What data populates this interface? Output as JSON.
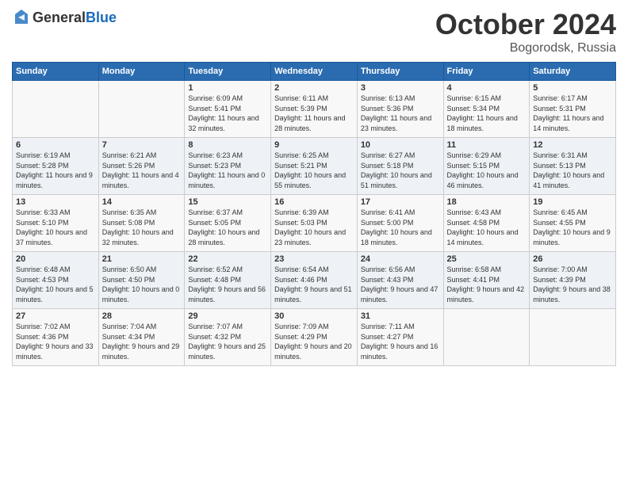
{
  "header": {
    "logo_general": "General",
    "logo_blue": "Blue",
    "month_title": "October 2024",
    "location": "Bogorodsk, Russia"
  },
  "days_of_week": [
    "Sunday",
    "Monday",
    "Tuesday",
    "Wednesday",
    "Thursday",
    "Friday",
    "Saturday"
  ],
  "weeks": [
    [
      {
        "day": "",
        "info": ""
      },
      {
        "day": "",
        "info": ""
      },
      {
        "day": "1",
        "info": "Sunrise: 6:09 AM\nSunset: 5:41 PM\nDaylight: 11 hours and 32 minutes."
      },
      {
        "day": "2",
        "info": "Sunrise: 6:11 AM\nSunset: 5:39 PM\nDaylight: 11 hours and 28 minutes."
      },
      {
        "day": "3",
        "info": "Sunrise: 6:13 AM\nSunset: 5:36 PM\nDaylight: 11 hours and 23 minutes."
      },
      {
        "day": "4",
        "info": "Sunrise: 6:15 AM\nSunset: 5:34 PM\nDaylight: 11 hours and 18 minutes."
      },
      {
        "day": "5",
        "info": "Sunrise: 6:17 AM\nSunset: 5:31 PM\nDaylight: 11 hours and 14 minutes."
      }
    ],
    [
      {
        "day": "6",
        "info": "Sunrise: 6:19 AM\nSunset: 5:28 PM\nDaylight: 11 hours and 9 minutes."
      },
      {
        "day": "7",
        "info": "Sunrise: 6:21 AM\nSunset: 5:26 PM\nDaylight: 11 hours and 4 minutes."
      },
      {
        "day": "8",
        "info": "Sunrise: 6:23 AM\nSunset: 5:23 PM\nDaylight: 11 hours and 0 minutes."
      },
      {
        "day": "9",
        "info": "Sunrise: 6:25 AM\nSunset: 5:21 PM\nDaylight: 10 hours and 55 minutes."
      },
      {
        "day": "10",
        "info": "Sunrise: 6:27 AM\nSunset: 5:18 PM\nDaylight: 10 hours and 51 minutes."
      },
      {
        "day": "11",
        "info": "Sunrise: 6:29 AM\nSunset: 5:15 PM\nDaylight: 10 hours and 46 minutes."
      },
      {
        "day": "12",
        "info": "Sunrise: 6:31 AM\nSunset: 5:13 PM\nDaylight: 10 hours and 41 minutes."
      }
    ],
    [
      {
        "day": "13",
        "info": "Sunrise: 6:33 AM\nSunset: 5:10 PM\nDaylight: 10 hours and 37 minutes."
      },
      {
        "day": "14",
        "info": "Sunrise: 6:35 AM\nSunset: 5:08 PM\nDaylight: 10 hours and 32 minutes."
      },
      {
        "day": "15",
        "info": "Sunrise: 6:37 AM\nSunset: 5:05 PM\nDaylight: 10 hours and 28 minutes."
      },
      {
        "day": "16",
        "info": "Sunrise: 6:39 AM\nSunset: 5:03 PM\nDaylight: 10 hours and 23 minutes."
      },
      {
        "day": "17",
        "info": "Sunrise: 6:41 AM\nSunset: 5:00 PM\nDaylight: 10 hours and 18 minutes."
      },
      {
        "day": "18",
        "info": "Sunrise: 6:43 AM\nSunset: 4:58 PM\nDaylight: 10 hours and 14 minutes."
      },
      {
        "day": "19",
        "info": "Sunrise: 6:45 AM\nSunset: 4:55 PM\nDaylight: 10 hours and 9 minutes."
      }
    ],
    [
      {
        "day": "20",
        "info": "Sunrise: 6:48 AM\nSunset: 4:53 PM\nDaylight: 10 hours and 5 minutes."
      },
      {
        "day": "21",
        "info": "Sunrise: 6:50 AM\nSunset: 4:50 PM\nDaylight: 10 hours and 0 minutes."
      },
      {
        "day": "22",
        "info": "Sunrise: 6:52 AM\nSunset: 4:48 PM\nDaylight: 9 hours and 56 minutes."
      },
      {
        "day": "23",
        "info": "Sunrise: 6:54 AM\nSunset: 4:46 PM\nDaylight: 9 hours and 51 minutes."
      },
      {
        "day": "24",
        "info": "Sunrise: 6:56 AM\nSunset: 4:43 PM\nDaylight: 9 hours and 47 minutes."
      },
      {
        "day": "25",
        "info": "Sunrise: 6:58 AM\nSunset: 4:41 PM\nDaylight: 9 hours and 42 minutes."
      },
      {
        "day": "26",
        "info": "Sunrise: 7:00 AM\nSunset: 4:39 PM\nDaylight: 9 hours and 38 minutes."
      }
    ],
    [
      {
        "day": "27",
        "info": "Sunrise: 7:02 AM\nSunset: 4:36 PM\nDaylight: 9 hours and 33 minutes."
      },
      {
        "day": "28",
        "info": "Sunrise: 7:04 AM\nSunset: 4:34 PM\nDaylight: 9 hours and 29 minutes."
      },
      {
        "day": "29",
        "info": "Sunrise: 7:07 AM\nSunset: 4:32 PM\nDaylight: 9 hours and 25 minutes."
      },
      {
        "day": "30",
        "info": "Sunrise: 7:09 AM\nSunset: 4:29 PM\nDaylight: 9 hours and 20 minutes."
      },
      {
        "day": "31",
        "info": "Sunrise: 7:11 AM\nSunset: 4:27 PM\nDaylight: 9 hours and 16 minutes."
      },
      {
        "day": "",
        "info": ""
      },
      {
        "day": "",
        "info": ""
      }
    ]
  ]
}
